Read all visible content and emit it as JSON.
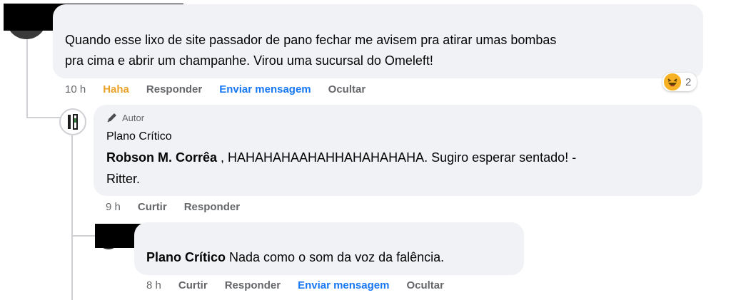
{
  "comment1": {
    "text_line1": "Quando esse lixo de site passador de pano fechar me avisem pra atirar umas bombas",
    "text_line2": "pra cima e abrir um champanhe. Virou uma sucursal do Omeleft!",
    "time": "10 h",
    "reaction_label": "Haha",
    "reply_label": "Responder",
    "message_label": "Enviar mensagem",
    "hide_label": "Ocultar",
    "reaction_icon": "laughing-emoji-icon",
    "reaction_count": "2"
  },
  "reply1": {
    "badge_icon": "pencil-icon",
    "badge_label": "Autor",
    "author": "Plano Crítico",
    "mention": "Robson M. Corrêa",
    "text_line1": " , HAHAHAHAAHAHHAHAHAHAHA. Sugiro esperar sentado! -",
    "text_line2": "Ritter.",
    "time": "9 h",
    "like_label": "Curtir",
    "reply_label": "Responder"
  },
  "reply2": {
    "mention": "Plano Crítico",
    "text": " Nada como o som da voz da falência.",
    "time": "8 h",
    "like_label": "Curtir",
    "reply_label": "Responder",
    "message_label": "Enviar mensagem",
    "hide_label": "Ocultar"
  },
  "colors": {
    "bubble": "#f0f2f5",
    "secondary_text": "#65676b",
    "link_blue": "#1877f2",
    "haha_yellow": "#e9a22c",
    "thread_line": "#ced0d4"
  }
}
